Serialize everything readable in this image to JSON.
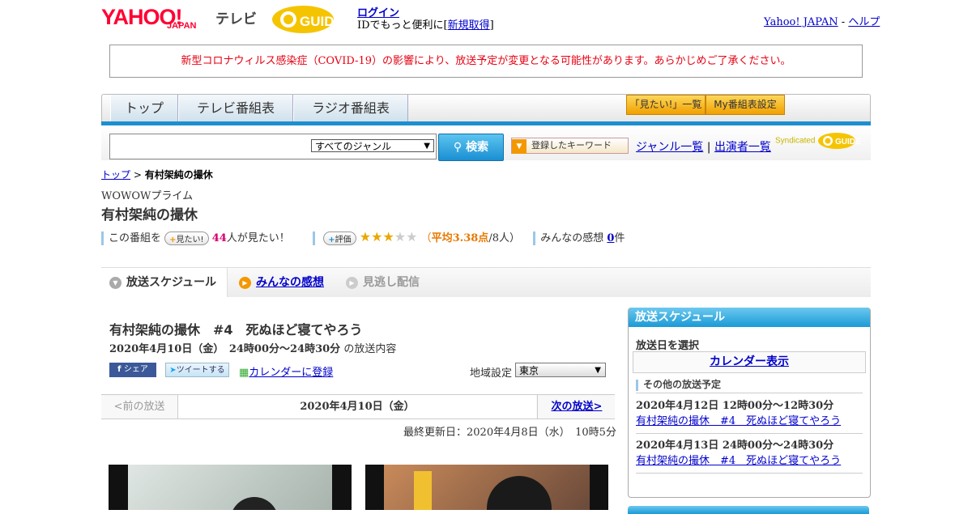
{
  "header": {
    "logo_yahoo": "YAHOO!",
    "logo_japan": "JAPAN",
    "logo_tv": "テレビ",
    "login": "ログイン",
    "id_prefix": "IDでもっと便利に[",
    "signup": "新規取得",
    "id_suffix": "]",
    "yahoo_japan": "Yahoo! JAPAN",
    "sep": "-",
    "help": "ヘルプ"
  },
  "notice": "新型コロナウィルス感染症（COVID-19）の影響により、放送予定が変更となる可能性があります。あらかじめご了承ください。",
  "nav": {
    "tabs": [
      "トップ",
      "テレビ番組表",
      "ラジオ番組表"
    ],
    "mitai_list": "「見たい!」一覧",
    "my_settings": "My番組表設定"
  },
  "search": {
    "genre_selected": "すべてのジャンル",
    "button": "検索",
    "keyword_button": "登録したキーワード",
    "genre_list": "ジャンル一覧",
    "divider": "|",
    "performer_list": "出演者一覧",
    "syndicated": "Syndicated"
  },
  "breadcrumb": {
    "top": "トップ",
    "sep": ">",
    "current": "有村架純の撮休"
  },
  "program": {
    "channel": "WOWOWプライム",
    "title": "有村架純の撮休",
    "this_show": "この番組を",
    "mitai_pill": "見たい!",
    "mitai_count": "44",
    "mitai_suffix": "人が見たい！",
    "rate_pill": "評価",
    "rating": 3,
    "rating_max": 5,
    "avg_open": "（",
    "avg": "平均3.38点",
    "avg_people": "/8人）",
    "impressions_label": "みんなの感想",
    "impressions_count": "0",
    "impressions_suffix": "件"
  },
  "tabs": {
    "schedule": "放送スケジュール",
    "impressions": "みんなの感想",
    "catchup": "見逃し配信"
  },
  "episode": {
    "title": "有村架純の撮休　#4　死ぬほど寝てやろう",
    "date": "2020年4月10日（金）　24時00分～24時30分",
    "date_suffix": "の放送内容",
    "share": "シェア",
    "tweet": "ツイートする",
    "calendar": "カレンダーに登録",
    "region_label": "地域設定",
    "region": "東京",
    "prev": "<前の放送",
    "current_date": "2020年4月10日（金）",
    "next": "次の放送>",
    "updated": "最終更新日：2020年4月8日（水）　10時5分"
  },
  "sidebar": {
    "header": "放送スケジュール",
    "select_date": "放送日を選択",
    "calendar_link": "カレンダー表示",
    "other_header": "その他の放送予定",
    "items": [
      {
        "date": "2020年4月12日  12時00分～12時30分",
        "title": "有村架純の撮休　#4　死ぬほど寝てやろう"
      },
      {
        "date": "2020年4月13日  24時00分～24時30分",
        "title": "有村架純の撮休　#4　死ぬほど寝てやろう"
      }
    ]
  },
  "colors": {
    "brand_red": "#ff0033",
    "accent_blue": "#1d8fd0",
    "notice_red": "#e60012",
    "rating_orange": "#e87800"
  }
}
